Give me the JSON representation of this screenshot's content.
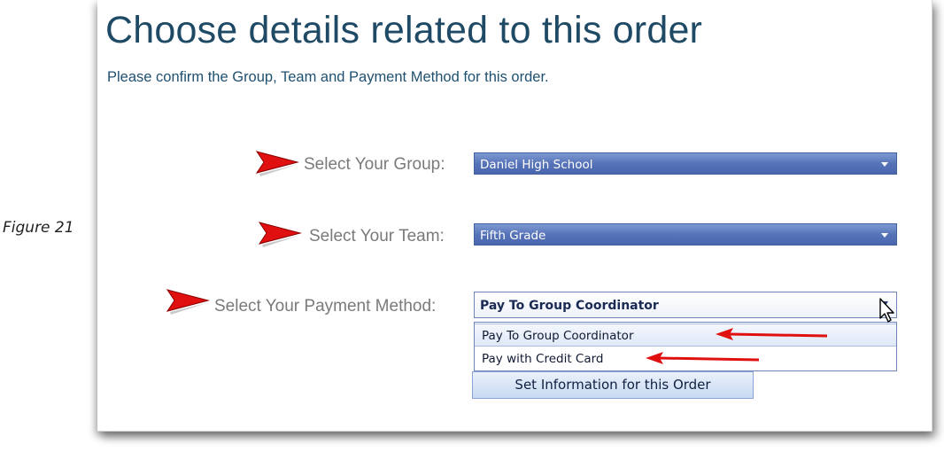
{
  "figure_caption": "Figure 21",
  "page": {
    "title": "Choose details related to this order",
    "subtitle": "Please confirm the Group, Team and Payment Method for this order."
  },
  "form": {
    "group": {
      "label": "Select Your Group:",
      "value": "Daniel High School"
    },
    "team": {
      "label": "Select Your Team:",
      "value": "Fifth Grade"
    },
    "payment": {
      "label": "Select Your Payment Method:",
      "value": "Pay To Group Coordinator",
      "options": [
        "Pay To Group Coordinator",
        "Pay with Credit Card"
      ]
    },
    "submit_label": "Set Information for this Order"
  },
  "colors": {
    "title": "#1f4a66",
    "select_bg": "#5673b8",
    "pointer_red": "#e01010"
  },
  "icons": [
    "pointer-arrow-icon",
    "red-annotation-arrow-icon",
    "mouse-cursor-icon",
    "dropdown-caret-icon"
  ]
}
